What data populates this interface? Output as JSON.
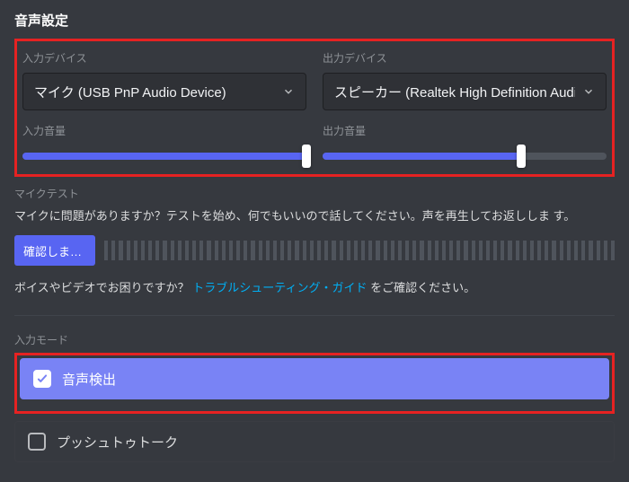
{
  "section_title": "音声設定",
  "devices": {
    "input_label": "入力デバイス",
    "output_label": "出力デバイス",
    "input_value": "マイク (USB PnP Audio Device)",
    "output_value": "スピーカー (Realtek High Definition Audio)"
  },
  "volume": {
    "input_label": "入力音量",
    "output_label": "出力音量",
    "input_percent": 100,
    "output_percent": 70
  },
  "mic_test": {
    "label": "マイクテスト",
    "help": "マイクに問題がありますか？テストを始め、何でもいいので話してください。声を再生してお返ししま す。",
    "button": "確認しまし..."
  },
  "troubleshoot": {
    "prefix": "ボイスやビデオでお困りですか？",
    "link": "トラブルシューティング・ガイド",
    "suffix": "をご確認ください。"
  },
  "input_mode": {
    "label": "入力モード",
    "voice_activity": "音声検出",
    "push_to_talk": "プッシュトゥトーク"
  }
}
